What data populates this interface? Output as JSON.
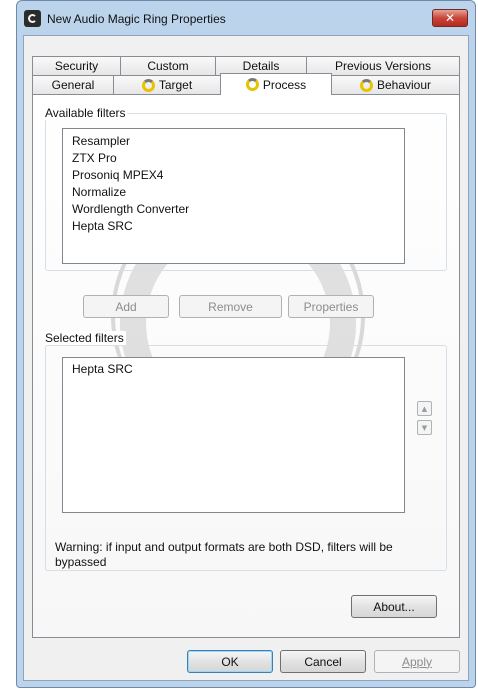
{
  "window": {
    "title": "New Audio Magic Ring Properties",
    "close_label": "✕"
  },
  "tabs": {
    "row1": [
      {
        "label": "Security"
      },
      {
        "label": "Custom"
      },
      {
        "label": "Details"
      },
      {
        "label": "Previous Versions"
      }
    ],
    "row2": [
      {
        "label": "General",
        "icon": ""
      },
      {
        "label": "Target",
        "icon": "ring-icon"
      },
      {
        "label": "Process",
        "icon": "ring-icon",
        "active": true
      },
      {
        "label": "Behaviour",
        "icon": "ring-icon"
      }
    ]
  },
  "available_filters": {
    "label": "Available filters",
    "items": [
      "Resampler",
      "ZTX Pro",
      "Prosoniq MPEX4",
      "Normalize",
      "Wordlength Converter",
      "Hepta SRC"
    ]
  },
  "filter_buttons": {
    "add": "Add",
    "remove": "Remove",
    "properties": "Properties"
  },
  "selected_filters": {
    "label": "Selected filters",
    "items": [
      "Hepta SRC"
    ],
    "up_icon": "▲",
    "down_icon": "▼"
  },
  "warning_text": "Warning: if input and output formats are both DSD, filters will be bypassed",
  "about_button": "About...",
  "footer": {
    "ok": "OK",
    "cancel": "Cancel",
    "apply": "Apply"
  },
  "colors": {
    "frame": "#bcd3ec",
    "close_button": "#c9463a",
    "tab_icon": "#e6c400"
  }
}
